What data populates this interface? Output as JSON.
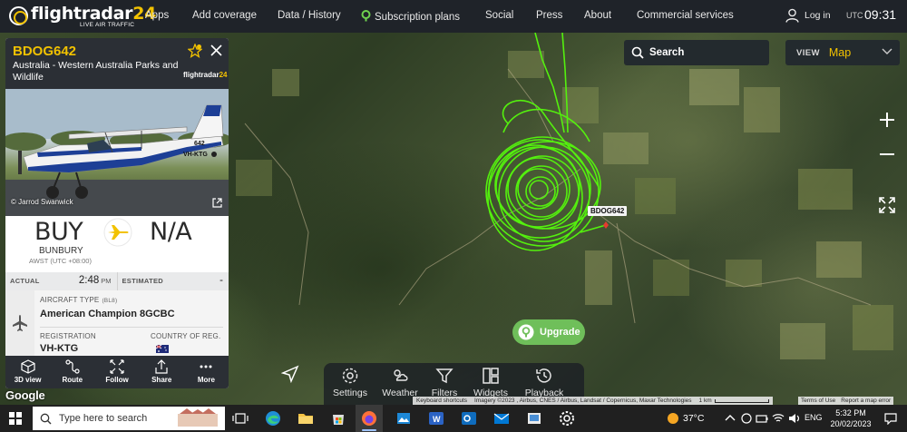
{
  "topbar": {
    "brand_name": "flightradar",
    "brand_num": "24",
    "brand_tagline": "LIVE AIR TRAFFIC",
    "nav": [
      "Apps",
      "Add coverage",
      "Data / History",
      "Subscription plans",
      "Social",
      "Press",
      "About",
      "Commercial services"
    ],
    "login_label": "Log in",
    "utc_label": "UTC",
    "clock": "09:31"
  },
  "map": {
    "search_label": "Search",
    "view_label": "VIEW",
    "view_value": "Map",
    "flight_label": "BDOG642",
    "upgrade_label": "Upgrade",
    "toolbar": [
      "Settings",
      "Weather",
      "Filters",
      "Widgets",
      "Playback"
    ],
    "google_label": "Google",
    "attribution": [
      "Keyboard shortcuts",
      "Imagery ©2023 , Airbus, CNES / Airbus, Landsat / Copernicus, Maxar Technologies",
      "1 km",
      "Terms of Use",
      "Report a map error"
    ],
    "track_color": "#54f00e"
  },
  "panel": {
    "callsign": "BDOG642",
    "owner": "Australia - Western Australia Parks and Wildlife",
    "mini_brand": "flightradar",
    "mini_brand_num": "24",
    "photo_credit": "© Jarrod Swanwick",
    "photo_reg": "VH-KTG",
    "photo_num": "642",
    "origin_code": "BUY",
    "origin_city": "BUNBURY",
    "origin_tz": "AWST (UTC +08:00)",
    "dest_code": "N/A",
    "actual_label": "ACTUAL",
    "actual_time": "2:48",
    "actual_ampm": "PM",
    "estimated_label": "ESTIMATED",
    "estimated_time": "-",
    "aircraft_type_label": "AIRCRAFT TYPE",
    "aircraft_type_code": "(BL8)",
    "aircraft_type": "American Champion 8GCBC",
    "registration_label": "REGISTRATION",
    "registration": "VH-KTG",
    "country_label": "COUNTRY OF REG.",
    "actions": [
      "3D view",
      "Route",
      "Follow",
      "Share",
      "More"
    ],
    "accent": "#f2c200"
  },
  "taskbar": {
    "search_placeholder": "Type here to search",
    "temperature": "37°C",
    "lang": "ENG",
    "time": "5:32 PM",
    "date": "20/02/2023"
  }
}
